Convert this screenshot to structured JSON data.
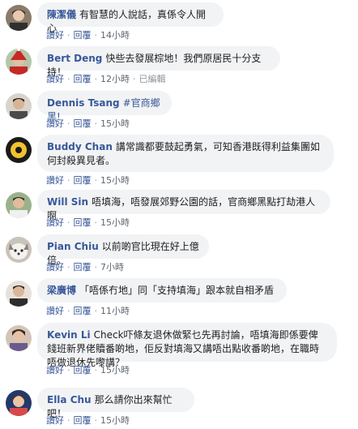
{
  "actions": {
    "like": "讚好",
    "reply": "回覆",
    "dot": "·"
  },
  "comments": [
    {
      "author": "陳潔儀",
      "text": "有智慧的人說話，真係令人開心",
      "time": "14小時",
      "edited": ""
    },
    {
      "author": "Bert Deng",
      "text": "快些去發展棕地！我們原居民十分支持！",
      "time": "12小時",
      "edited": "已編輯"
    },
    {
      "author": "Dennis Tsang",
      "text": "",
      "hashtag": "#官商鄉黑!",
      "time": "15小時",
      "edited": ""
    },
    {
      "author": "Buddy Chan",
      "text": "講常識都要鼓起勇氣，可知香港既得利益集團如何封殺異見者。",
      "time": "15小時",
      "edited": ""
    },
    {
      "author": "Will Sin",
      "text": "唔填海，唔發展郊野公園的話，官商鄉黑點打劫港人啊",
      "time": "15小時",
      "edited": ""
    },
    {
      "author": "Pian Chiu",
      "text": "以前啲官比現在好上億倍。",
      "time": "7小時",
      "edited": ""
    },
    {
      "author": "梁廣博",
      "text": "「唔係冇地」同「支持填海」跟本就自相矛盾",
      "time": "11小時",
      "edited": ""
    },
    {
      "author": "Kevin Li",
      "text": "Check吓條友退休做緊乜先再討論，唔填海即係要俾錢班新界佬贖番啲地，佢反對填海又講唔出點收番啲地，在職時唔做退休先嚟講？",
      "time": "15小時",
      "edited": ""
    },
    {
      "author": "Ella Chu",
      "text": "那么請你出來幫忙吧！",
      "time": "15小時",
      "edited": ""
    }
  ],
  "colors": {
    "link": "#385898",
    "bubble": "#f2f3f5",
    "text": "#1c1e21",
    "meta": "#606770"
  }
}
